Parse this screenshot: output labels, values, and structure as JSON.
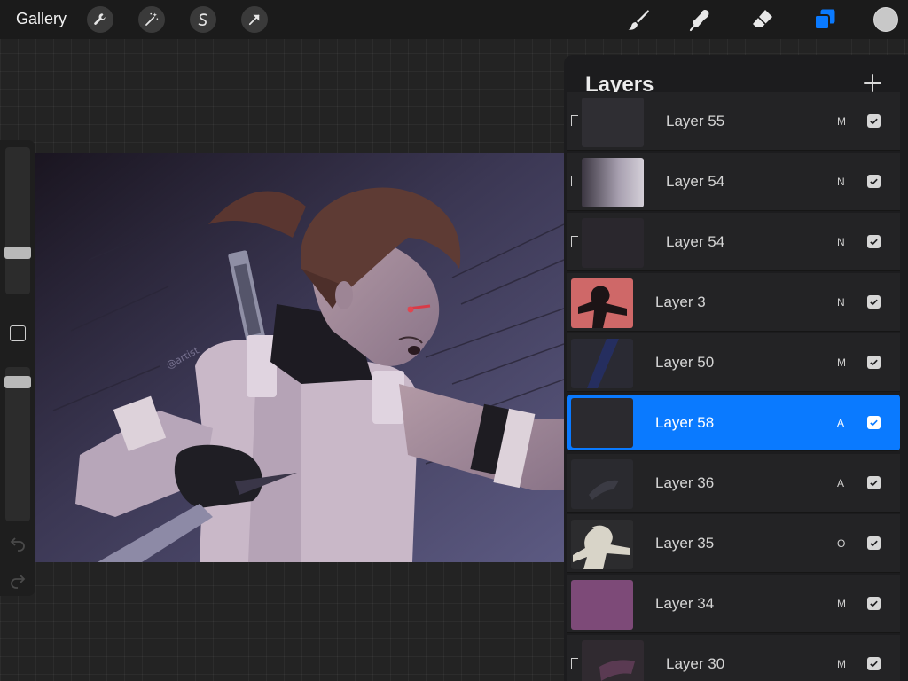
{
  "toolbar": {
    "gallery_label": "Gallery",
    "left_tools": [
      "wrench-icon",
      "magic-wand-icon",
      "selection-s-icon",
      "transform-arrow-icon"
    ],
    "right_tools": [
      "brush-icon",
      "smudge-icon",
      "eraser-icon",
      "layers-icon"
    ],
    "active_tool": "layers-icon",
    "accent_color": "#0a7aff",
    "current_color": "#c8c8c8"
  },
  "sidebar": {
    "brush_size_level": 0.26,
    "opacity_level": 0.94
  },
  "layers_panel": {
    "title": "Layers",
    "layers": [
      {
        "name": "Layer 55",
        "blend": "M",
        "clipped": true,
        "visible": true,
        "selected": false
      },
      {
        "name": "Layer 54",
        "blend": "N",
        "clipped": true,
        "visible": true,
        "selected": false
      },
      {
        "name": "Layer 54",
        "blend": "N",
        "clipped": true,
        "visible": true,
        "selected": false
      },
      {
        "name": "Layer 3",
        "blend": "N",
        "clipped": false,
        "visible": true,
        "selected": false
      },
      {
        "name": "Layer 50",
        "blend": "M",
        "clipped": false,
        "visible": true,
        "selected": false
      },
      {
        "name": "Layer 58",
        "blend": "A",
        "clipped": false,
        "visible": true,
        "selected": true
      },
      {
        "name": "Layer 36",
        "blend": "A",
        "clipped": false,
        "visible": true,
        "selected": false
      },
      {
        "name": "Layer 35",
        "blend": "O",
        "clipped": false,
        "visible": true,
        "selected": false
      },
      {
        "name": "Layer 34",
        "blend": "M",
        "clipped": false,
        "visible": true,
        "selected": false
      },
      {
        "name": "Layer 30",
        "blend": "M",
        "clipped": true,
        "visible": true,
        "selected": false
      }
    ]
  }
}
